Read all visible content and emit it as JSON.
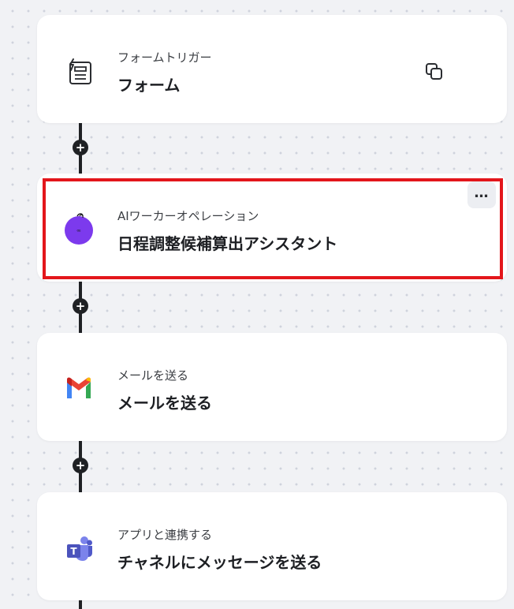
{
  "flow": {
    "steps": [
      {
        "label": "フォームトリガー",
        "title": "フォーム",
        "icon": "form-icon"
      },
      {
        "label": "AIワーカーオペレーション",
        "title": "日程調整候補算出アシスタント",
        "icon": "ai-worker-icon",
        "selected": true,
        "more_label": "…"
      },
      {
        "label": "メールを送る",
        "title": "メールを送る",
        "icon": "gmail-icon"
      },
      {
        "label": "アプリと連携する",
        "title": "チャネルにメッセージを送る",
        "icon": "teams-icon"
      }
    ],
    "add_step_symbol": "+"
  },
  "colors": {
    "background": "#f1f2f5",
    "card": "#ffffff",
    "connector": "#1f2124",
    "ai_purple": "#7c3aed",
    "highlight": "#e3161b"
  }
}
